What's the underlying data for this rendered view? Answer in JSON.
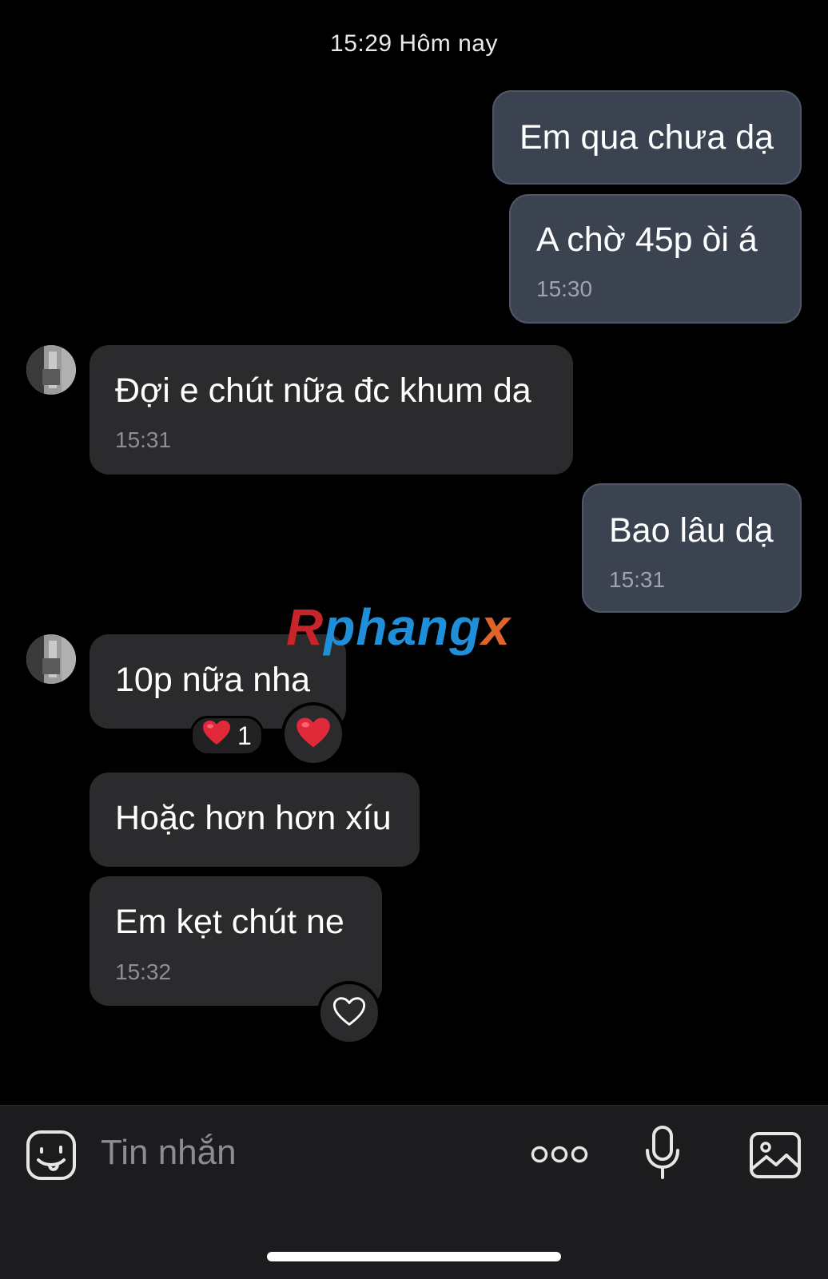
{
  "chat": {
    "date_separator": "15:29 Hôm nay",
    "messages": [
      {
        "direction": "out",
        "text": "Em qua chưa dạ",
        "time": ""
      },
      {
        "direction": "out",
        "text": "A chờ 45p òi á",
        "time": "15:30"
      },
      {
        "direction": "in",
        "text": "Đợi e chút nữa đc khum da",
        "time": "15:31"
      },
      {
        "direction": "out",
        "text": "Bao lâu dạ",
        "time": "15:31"
      },
      {
        "direction": "in",
        "text": "10p nữa nha",
        "time": "",
        "reaction_count": "1"
      },
      {
        "direction": "in",
        "text": "Hoặc hơn hơn xíu",
        "time": ""
      },
      {
        "direction": "in",
        "text": "Em kẹt chút ne",
        "time": "15:32"
      }
    ]
  },
  "watermark": {
    "part1": "R",
    "part2": "phang",
    "part3": "x"
  },
  "composer": {
    "placeholder": "Tin nhắn",
    "icons": [
      "sticker-icon",
      "more-icon",
      "microphone-icon",
      "image-icon"
    ]
  },
  "colors": {
    "outgoing_bubble": "#3b4351",
    "incoming_bubble": "#2b2b2d",
    "background": "#000000",
    "heart": "#e02a3a"
  }
}
